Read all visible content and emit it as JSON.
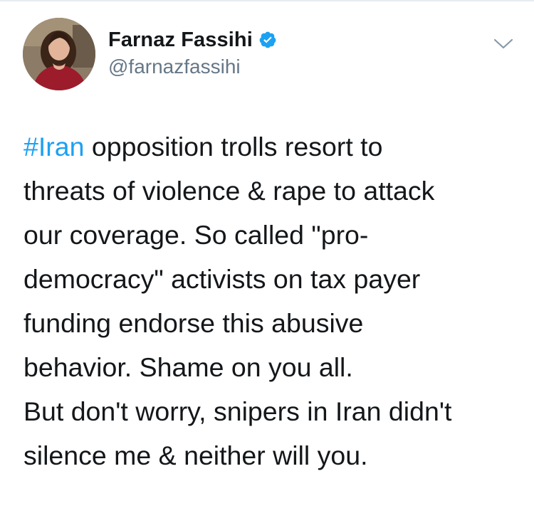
{
  "author": {
    "display_name": "Farnaz Fassihi",
    "handle": "@farnazfassihi",
    "verified": true
  },
  "tweet": {
    "hashtag": "#Iran",
    "lines": [
      " opposition trolls resort to",
      "threats of violence & rape to attack",
      "our coverage. So called \"pro-",
      "democracy\" activists on tax payer",
      "funding endorse this abusive",
      "behavior. Shame on you all.",
      "But don't worry, snipers in Iran didn't",
      "silence me & neither will you."
    ]
  },
  "icons": {
    "verified": "verified-badge-icon",
    "menu": "chevron-down-icon"
  },
  "colors": {
    "link": "#1da1f2",
    "verified": "#1da1f2",
    "text": "#14171a",
    "secondary_text": "#657786"
  }
}
